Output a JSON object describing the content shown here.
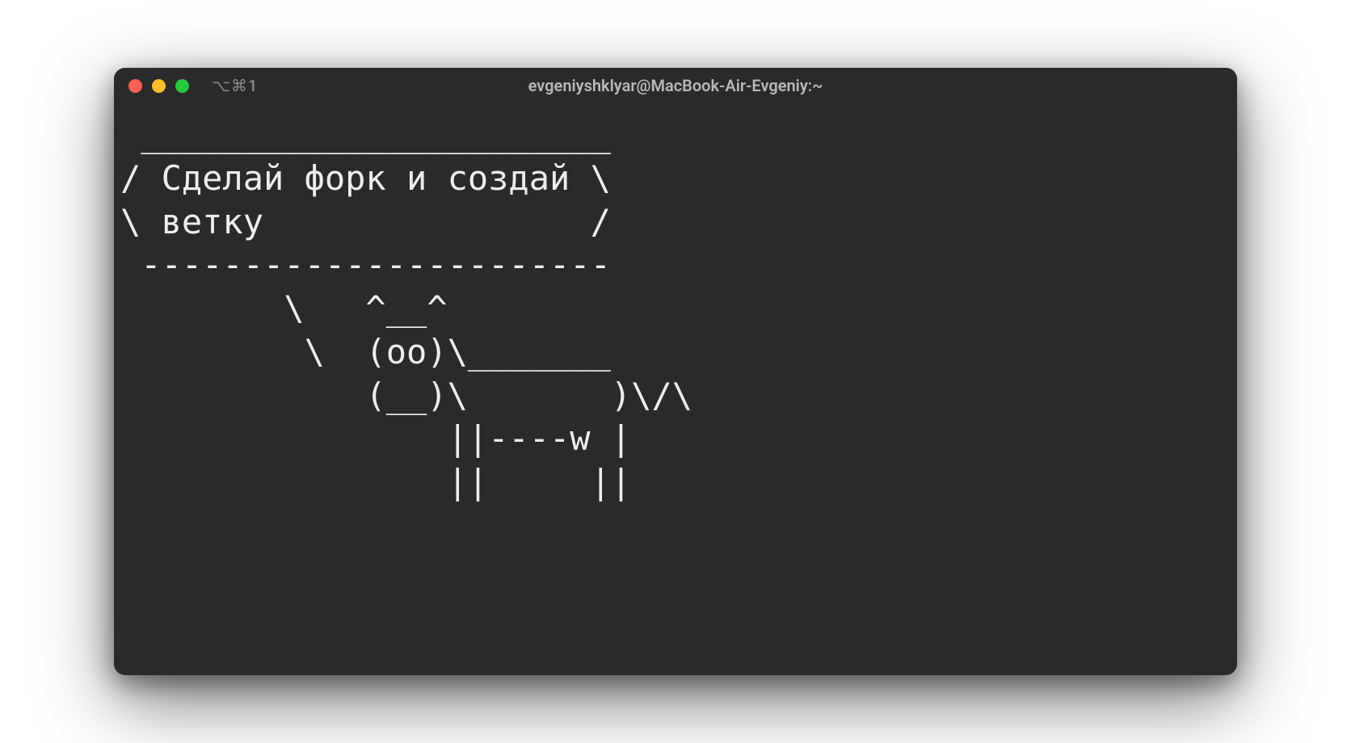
{
  "window": {
    "tab_label": "⌥⌘1",
    "title": "evgeniyshklyar@MacBook-Air-Evgeniy:~"
  },
  "terminal": {
    "output": " _______________________\n/ Сделай форк и создай \\\n\\ ветку                /\n -----------------------\n        \\   ^__^\n         \\  (oo)\\_______\n            (__)\\       )\\/\\\n                ||----w |\n                ||     ||"
  }
}
